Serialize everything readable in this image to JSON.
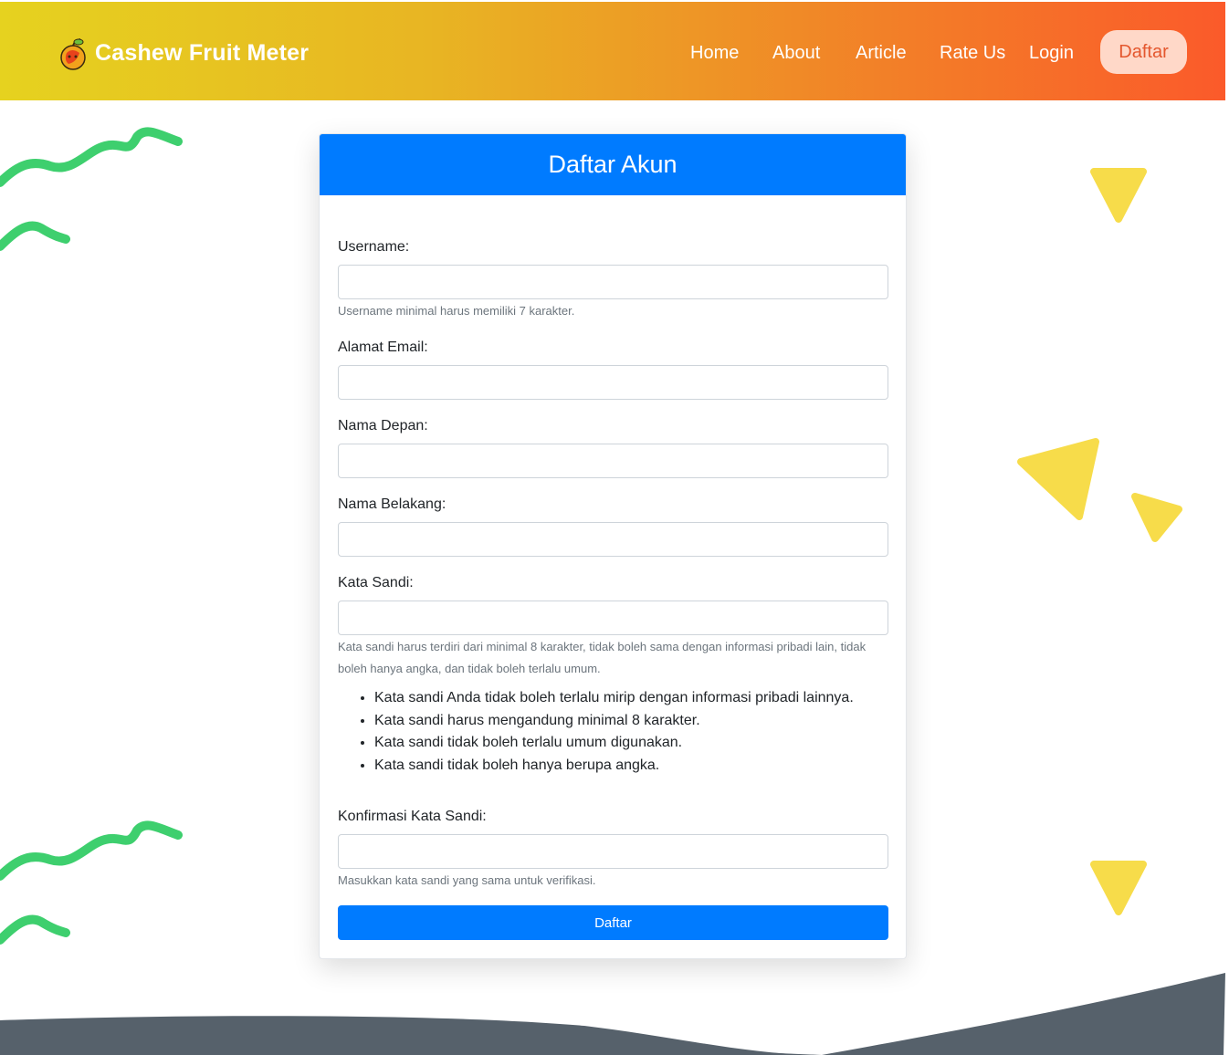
{
  "navbar": {
    "brand": "Cashew Fruit Meter",
    "links": [
      "Home",
      "About",
      "Article",
      "Rate Us",
      "Login"
    ],
    "cta": "Daftar"
  },
  "form": {
    "title": "Daftar Akun",
    "username_label": "Username:",
    "username_help": "Username minimal harus memiliki 7 karakter.",
    "email_label": "Alamat Email:",
    "first_name_label": "Nama Depan:",
    "last_name_label": "Nama Belakang:",
    "password_label": "Kata Sandi:",
    "password_help": "Kata sandi harus terdiri dari minimal 8 karakter, tidak boleh sama dengan informasi pribadi lain, tidak boleh hanya angka, dan tidak boleh terlalu umum.",
    "password_rules": [
      "Kata sandi Anda tidak boleh terlalu mirip dengan informasi pribadi lainnya.",
      "Kata sandi harus mengandung minimal 8 karakter.",
      "Kata sandi tidak boleh terlalu umum digunakan.",
      "Kata sandi tidak boleh hanya berupa angka."
    ],
    "confirm_label": "Konfirmasi Kata Sandi:",
    "confirm_help": "Masukkan kata sandi yang sama untuk verifikasi.",
    "submit_label": "Daftar"
  },
  "colors": {
    "primary": "#007bff",
    "wave_green": "#3ecf6e",
    "triangle_yellow": "#f7dc4a",
    "footer_gray": "#56616b"
  },
  "icons": {
    "brand_logo": "cashew-fruit-icon"
  }
}
